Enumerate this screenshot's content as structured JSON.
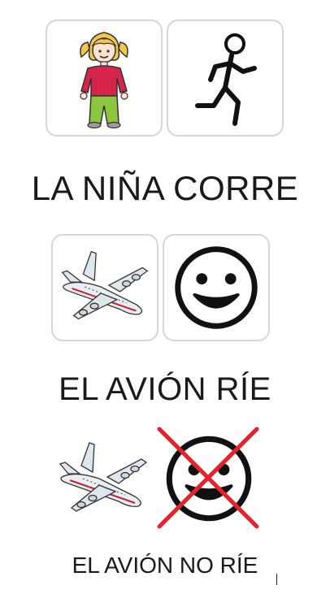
{
  "rows": [
    {
      "sentence": "LA NIÑA CORRE",
      "pictograms": [
        "girl-pictogram",
        "running-person-pictogram"
      ]
    },
    {
      "sentence": "EL AVIÓN RÍE",
      "pictograms": [
        "airplane-pictogram",
        "smiling-face-pictogram"
      ]
    },
    {
      "sentence": "EL AVIÓN NO RÍE",
      "pictograms": [
        "airplane-pictogram",
        "crossed-out-smiling-face-pictogram"
      ]
    }
  ],
  "colors": {
    "card_border": "#d6d6d6",
    "text": "#1a1a1a",
    "girl_hair": "#f6c64a",
    "girl_shirt": "#d6254a",
    "girl_pants": "#8cc63f",
    "negation_cross": "#e8212b",
    "plane_body": "#e9eef2",
    "plane_stripe": "#c8202a"
  }
}
